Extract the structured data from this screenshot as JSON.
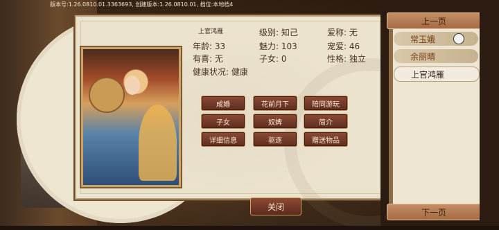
{
  "version_line": "版本号:1.26.0810.01.3363693, 创建版本:1.26.0810.01, 档位:本地档4",
  "character": {
    "name": "上官鸿雁",
    "stats": {
      "rank_label": "级别:",
      "rank_value": "知己",
      "nickname_label": "爱称:",
      "nickname_value": "无",
      "age_label": "年龄:",
      "age_value": "33",
      "charm_label": "魅力:",
      "charm_value": "103",
      "favor_label": "宠爱:",
      "favor_value": "46",
      "pregnant_label": "有喜:",
      "pregnant_value": "无",
      "children_label": "子女:",
      "children_value": "0",
      "personality_label": "性格:",
      "personality_value": "独立",
      "health_label": "健康状况:",
      "health_value": "健康"
    }
  },
  "actions": [
    "成婚",
    "花前月下",
    "陪同游玩",
    "子女",
    "奴婢",
    "简介",
    "详细信息",
    "驱逐",
    "赠送物品"
  ],
  "close_label": "关闭",
  "sidebar": {
    "prev_label": "上一页",
    "next_label": "下一页",
    "items": [
      {
        "label": "常玉娥",
        "selected": false
      },
      {
        "label": "余丽晴",
        "selected": false
      },
      {
        "label": "上官鸿雁",
        "selected": true
      }
    ]
  }
}
